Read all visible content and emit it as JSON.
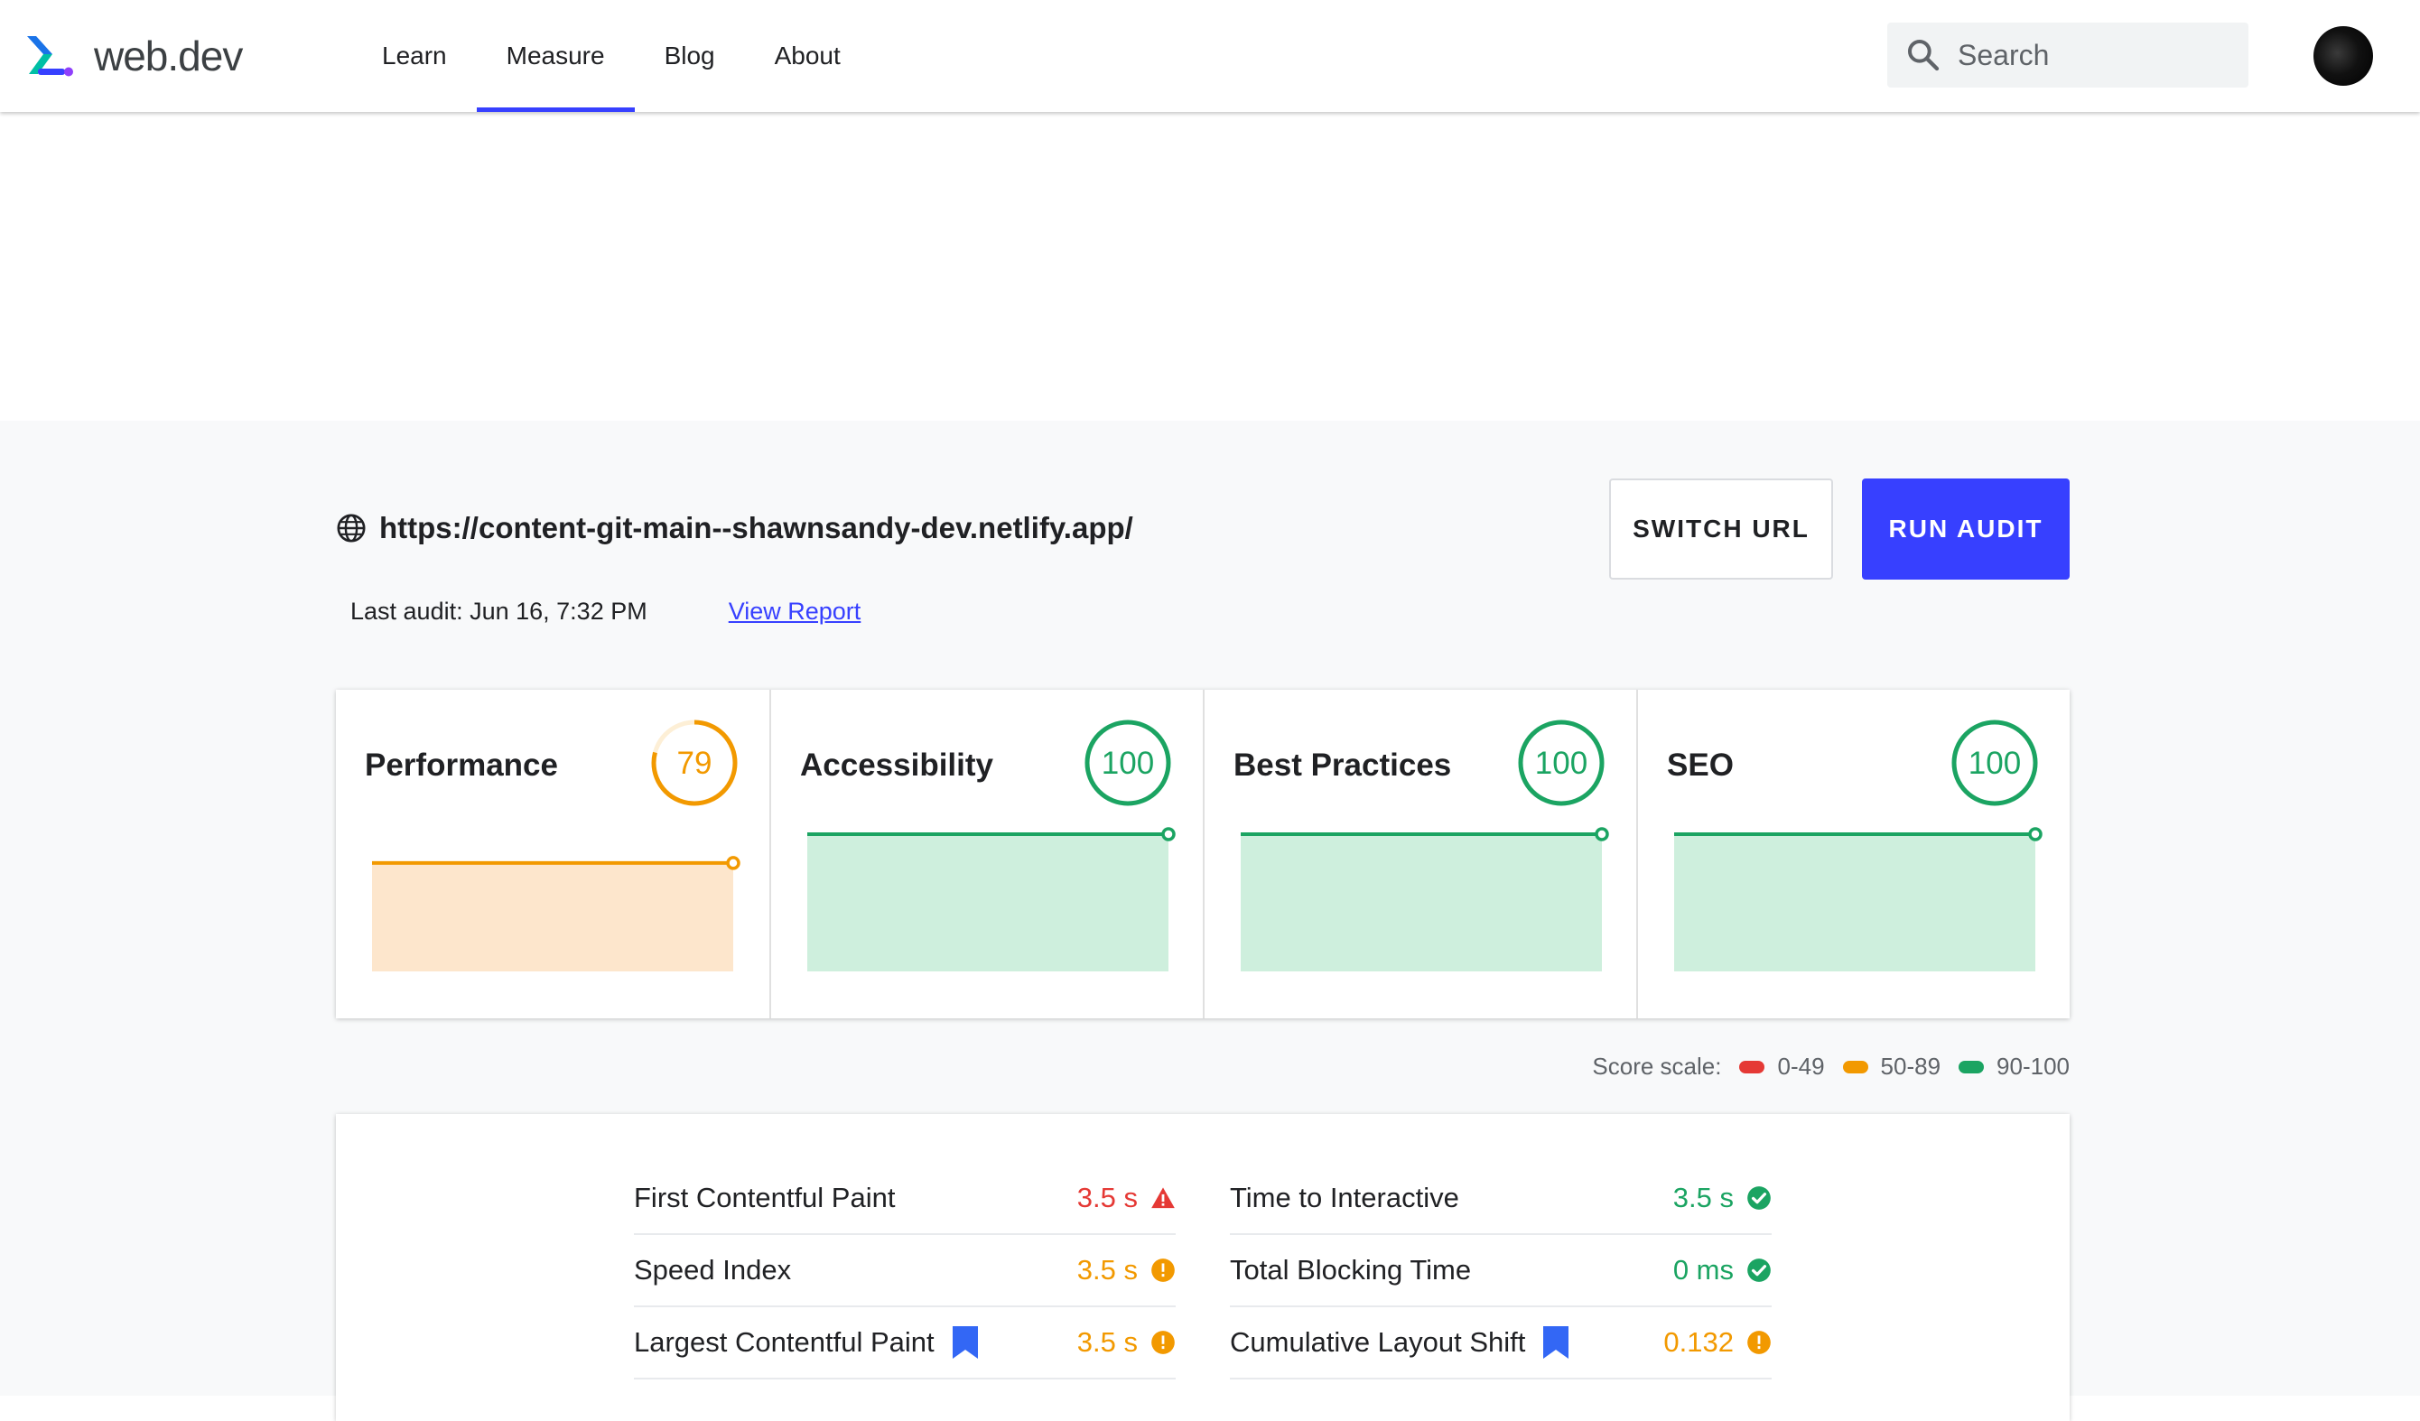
{
  "header": {
    "logo_text": "web.dev",
    "nav": [
      {
        "label": "Learn",
        "active": false
      },
      {
        "label": "Measure",
        "active": true
      },
      {
        "label": "Blog",
        "active": false
      },
      {
        "label": "About",
        "active": false
      }
    ],
    "search_placeholder": "Search"
  },
  "audit": {
    "url": "https://content-git-main--shawnsandy-dev.netlify.app/",
    "last_audit": "Last audit: Jun 16, 7:32 PM",
    "view_report": "View Report",
    "switch_url": "SWITCH URL",
    "run_audit": "RUN AUDIT"
  },
  "scores": [
    {
      "title": "Performance",
      "score": 79,
      "color": "#f29900",
      "fill": "#fde6cc"
    },
    {
      "title": "Accessibility",
      "score": 100,
      "color": "#1ba462",
      "fill": "#ceefdd"
    },
    {
      "title": "Best Practices",
      "score": 100,
      "color": "#1ba462",
      "fill": "#ceefdd"
    },
    {
      "title": "SEO",
      "score": 100,
      "color": "#1ba462",
      "fill": "#ceefdd"
    }
  ],
  "scale": {
    "label": "Score scale:",
    "ranges": [
      {
        "label": "0-49",
        "color": "#e53935"
      },
      {
        "label": "50-89",
        "color": "#f29900"
      },
      {
        "label": "90-100",
        "color": "#1ba462"
      }
    ]
  },
  "metrics": {
    "left": [
      {
        "name": "First Contentful Paint",
        "value": "3.5 s",
        "status": "fail",
        "color": "#e53935",
        "bookmark": false
      },
      {
        "name": "Speed Index",
        "value": "3.5 s",
        "status": "average",
        "color": "#f29900",
        "bookmark": false
      },
      {
        "name": "Largest Contentful Paint",
        "value": "3.5 s",
        "status": "average",
        "color": "#f29900",
        "bookmark": true
      }
    ],
    "right": [
      {
        "name": "Time to Interactive",
        "value": "3.5 s",
        "status": "pass",
        "color": "#1ba462",
        "bookmark": false
      },
      {
        "name": "Total Blocking Time",
        "value": "0 ms",
        "status": "pass",
        "color": "#1ba462",
        "bookmark": false
      },
      {
        "name": "Cumulative Layout Shift",
        "value": "0.132",
        "status": "average",
        "color": "#f29900",
        "bookmark": true
      }
    ]
  },
  "icons": {
    "logo": "webdev-logo-icon",
    "search": "search-icon",
    "globe": "globe-icon",
    "fail": "warning-triangle-icon",
    "average": "info-circle-icon",
    "pass": "check-circle-icon",
    "bookmark": "bookmark-icon"
  }
}
